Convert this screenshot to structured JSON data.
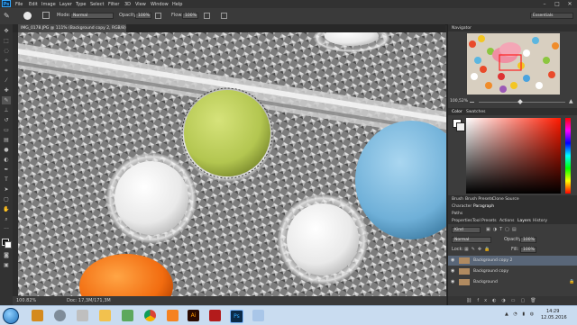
{
  "app": {
    "logo": "Ps"
  },
  "menu": [
    "File",
    "Edit",
    "Image",
    "Layer",
    "Type",
    "Select",
    "Filter",
    "3D",
    "View",
    "Window",
    "Help"
  ],
  "window_controls": {
    "minimize": "–",
    "maximize": "□",
    "close": "✕"
  },
  "options": {
    "mode_label": "Mode:",
    "mode_value": "Normal",
    "opacity_label": "Opacity:",
    "opacity_value": "100%",
    "flow_label": "Flow:",
    "flow_value": "100%",
    "workspace": "Essentials"
  },
  "document": {
    "tab_title": "IMG_0178.JPG @ 111% (Background copy 2, RGB/8) *",
    "zoom": "100.82%",
    "doc_size": "Doc: 17,3M/171,3M"
  },
  "navigator": {
    "tab": "Navigator",
    "zoom": "100,52%"
  },
  "color": {
    "tabs": [
      "Color",
      "Swatches"
    ]
  },
  "brush_tabs": [
    "Brush",
    "Brush Presets",
    "Clone Source"
  ],
  "char_tabs": [
    "Character",
    "Paragraph"
  ],
  "paths_tab": "Paths",
  "layers_tabs": [
    "Properties",
    "Tool Presets",
    "Actions",
    "Layers",
    "History"
  ],
  "layers": {
    "kind": "Kind",
    "blend": "Normal",
    "opacity_label": "Opacity:",
    "opacity_value": "100%",
    "lock_label": "Lock:",
    "fill_label": "Fill:",
    "fill_value": "100%",
    "items": [
      {
        "name": "Background copy 2",
        "selected": true
      },
      {
        "name": "Background copy",
        "selected": false
      },
      {
        "name": "Background",
        "selected": false
      }
    ]
  },
  "taskbar": {
    "time": "14:29",
    "date": "12.05.2016"
  },
  "colors": {
    "accent": "#31a8ff",
    "panel": "#3c3c3c",
    "selected_layer": "#596678"
  }
}
